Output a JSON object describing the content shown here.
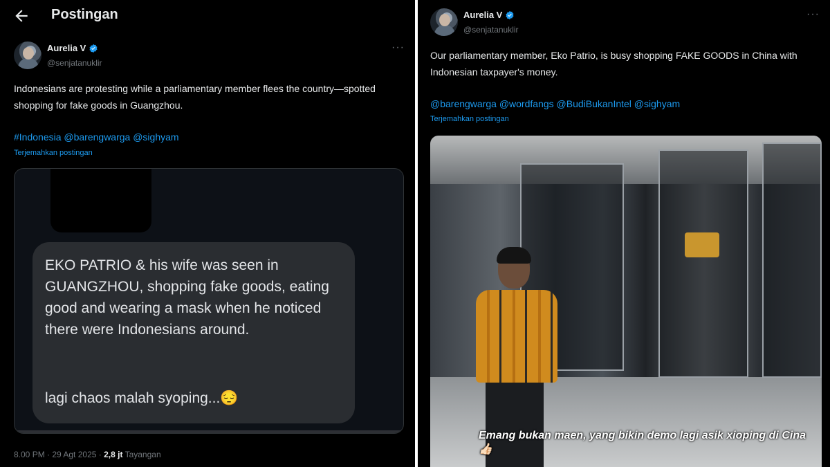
{
  "left": {
    "header_title": "Postingan",
    "author_name": "Aurelia V",
    "author_handle": "@senjatanuklir",
    "text": "Indonesians are protesting while a parliamentary member flees the country—spotted shopping for fake goods in Guangzhou.",
    "hashtags": "#Indonesia @barengwarga @sighyam",
    "translate": "Terjemahkan postingan",
    "image_message": "EKO PATRIO & his wife was seen in GUANGZHOU, shopping fake goods, eating good and wearing a mask when he noticed there were Indonesians around.",
    "image_message_2": "lagi chaos malah syoping...😔",
    "timestamp": "8.00 PM · 29 Agt 2025 ·",
    "views_count": "2,8 jt",
    "views_label": "Tayangan"
  },
  "right": {
    "author_name": "Aurelia V",
    "author_handle": "@senjatanuklir",
    "text": "Our parliamentary member, Eko Patrio, is busy shopping FAKE GOODS in China with Indonesian taxpayer's money.",
    "mentions": "@barengwarga @wordfangs @BudiBukanIntel @sighyam",
    "translate": "Terjemahkan postingan",
    "video_caption": "Emang bukan maen, yang bikin demo lagi asik xioping di Cina 👍🏻"
  },
  "colors": {
    "accent": "#1d9bf0",
    "background": "#000000",
    "muted": "#71767b"
  }
}
